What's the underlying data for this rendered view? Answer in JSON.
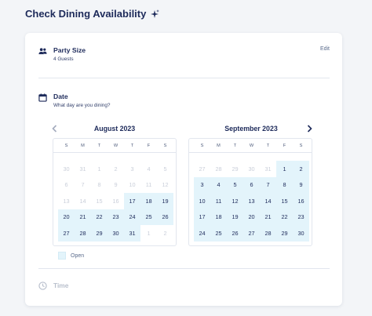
{
  "page": {
    "title": "Check Dining Availability"
  },
  "party": {
    "title": "Party Size",
    "value": "4 Guests",
    "edit_label": "Edit"
  },
  "date": {
    "title": "Date",
    "subtitle": "What day are you dining?"
  },
  "weekdays": [
    "S",
    "M",
    "T",
    "W",
    "T",
    "F",
    "S"
  ],
  "calendars": [
    {
      "month_label": "August 2023",
      "weeks": [
        [
          {
            "d": "30",
            "open": false
          },
          {
            "d": "31",
            "open": false
          },
          {
            "d": "1",
            "open": false
          },
          {
            "d": "2",
            "open": false
          },
          {
            "d": "3",
            "open": false
          },
          {
            "d": "4",
            "open": false
          },
          {
            "d": "5",
            "open": false
          }
        ],
        [
          {
            "d": "6",
            "open": false
          },
          {
            "d": "7",
            "open": false
          },
          {
            "d": "8",
            "open": false
          },
          {
            "d": "9",
            "open": false
          },
          {
            "d": "10",
            "open": false
          },
          {
            "d": "11",
            "open": false
          },
          {
            "d": "12",
            "open": false
          }
        ],
        [
          {
            "d": "13",
            "open": false
          },
          {
            "d": "14",
            "open": false
          },
          {
            "d": "15",
            "open": false
          },
          {
            "d": "16",
            "open": false
          },
          {
            "d": "17",
            "open": true
          },
          {
            "d": "18",
            "open": true
          },
          {
            "d": "19",
            "open": true
          }
        ],
        [
          {
            "d": "20",
            "open": true
          },
          {
            "d": "21",
            "open": true
          },
          {
            "d": "22",
            "open": true
          },
          {
            "d": "23",
            "open": true
          },
          {
            "d": "24",
            "open": true
          },
          {
            "d": "25",
            "open": true
          },
          {
            "d": "26",
            "open": true
          }
        ],
        [
          {
            "d": "27",
            "open": true
          },
          {
            "d": "28",
            "open": true
          },
          {
            "d": "29",
            "open": true
          },
          {
            "d": "30",
            "open": true
          },
          {
            "d": "31",
            "open": true
          },
          {
            "d": "1",
            "open": false
          },
          {
            "d": "2",
            "open": false
          }
        ]
      ]
    },
    {
      "month_label": "September 2023",
      "weeks": [
        [
          {
            "d": "27",
            "open": false
          },
          {
            "d": "28",
            "open": false
          },
          {
            "d": "29",
            "open": false
          },
          {
            "d": "30",
            "open": false
          },
          {
            "d": "31",
            "open": false
          },
          {
            "d": "1",
            "open": true
          },
          {
            "d": "2",
            "open": true
          }
        ],
        [
          {
            "d": "3",
            "open": true
          },
          {
            "d": "4",
            "open": true
          },
          {
            "d": "5",
            "open": true
          },
          {
            "d": "6",
            "open": true
          },
          {
            "d": "7",
            "open": true
          },
          {
            "d": "8",
            "open": true
          },
          {
            "d": "9",
            "open": true
          }
        ],
        [
          {
            "d": "10",
            "open": true
          },
          {
            "d": "11",
            "open": true
          },
          {
            "d": "12",
            "open": true
          },
          {
            "d": "13",
            "open": true
          },
          {
            "d": "14",
            "open": true
          },
          {
            "d": "15",
            "open": true
          },
          {
            "d": "16",
            "open": true
          }
        ],
        [
          {
            "d": "17",
            "open": true
          },
          {
            "d": "18",
            "open": true
          },
          {
            "d": "19",
            "open": true
          },
          {
            "d": "20",
            "open": true
          },
          {
            "d": "21",
            "open": true
          },
          {
            "d": "22",
            "open": true
          },
          {
            "d": "23",
            "open": true
          }
        ],
        [
          {
            "d": "24",
            "open": true
          },
          {
            "d": "25",
            "open": true
          },
          {
            "d": "26",
            "open": true
          },
          {
            "d": "27",
            "open": true
          },
          {
            "d": "28",
            "open": true
          },
          {
            "d": "29",
            "open": true
          },
          {
            "d": "30",
            "open": true
          }
        ]
      ]
    }
  ],
  "legend": {
    "open_label": "Open"
  },
  "time": {
    "title": "Time"
  },
  "icons": {
    "title": "sparkle-icon",
    "party": "people-icon",
    "date": "calendar-icon",
    "prev": "chevron-left-icon",
    "next": "chevron-right-icon",
    "time": "clock-icon"
  },
  "colors": {
    "navy": "#1d2a5a",
    "open_fill": "#e3f4fb",
    "disabled_text": "#c9ced9",
    "border": "#e2e6ee",
    "background": "#f3f5f8"
  }
}
